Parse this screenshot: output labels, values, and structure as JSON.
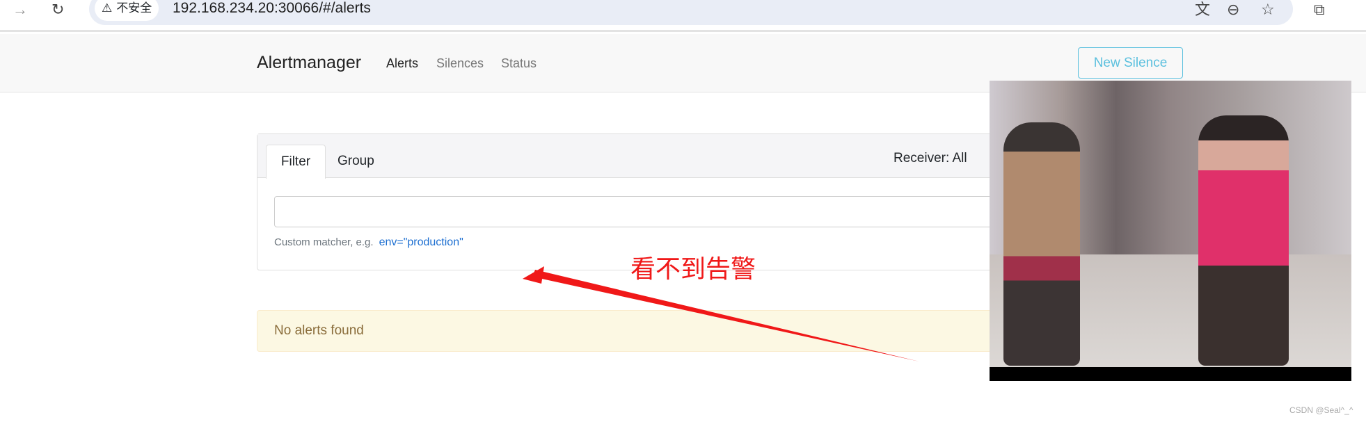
{
  "browser": {
    "security_label": "不安全",
    "url": "192.168.234.20:30066/#/alerts",
    "icons": [
      "back-arrow-icon",
      "reload-icon",
      "warning-icon",
      "translate-icon",
      "zoom-out-icon",
      "star-icon",
      "extensions-icon"
    ]
  },
  "navbar": {
    "brand": "Alertmanager",
    "links": [
      {
        "label": "Alerts",
        "active": true
      },
      {
        "label": "Silences",
        "active": false
      },
      {
        "label": "Status",
        "active": false
      }
    ],
    "new_silence": "New Silence"
  },
  "filter_card": {
    "tabs": [
      {
        "label": "Filter",
        "active": true
      },
      {
        "label": "Group",
        "active": false
      }
    ],
    "receiver": "Receiver: All",
    "input_value": "",
    "help_text": "Custom matcher, e.g.",
    "help_example": "env=\"production\""
  },
  "alerts": {
    "empty_message": "No alerts found"
  },
  "annotation": {
    "text": "看不到告警",
    "color": "#f01818"
  },
  "watermark": "CSDN @Seal^_^",
  "colors": {
    "accent": "#5bc0de",
    "link": "#1d6fd1",
    "warning_bg": "#fcf8e3"
  }
}
